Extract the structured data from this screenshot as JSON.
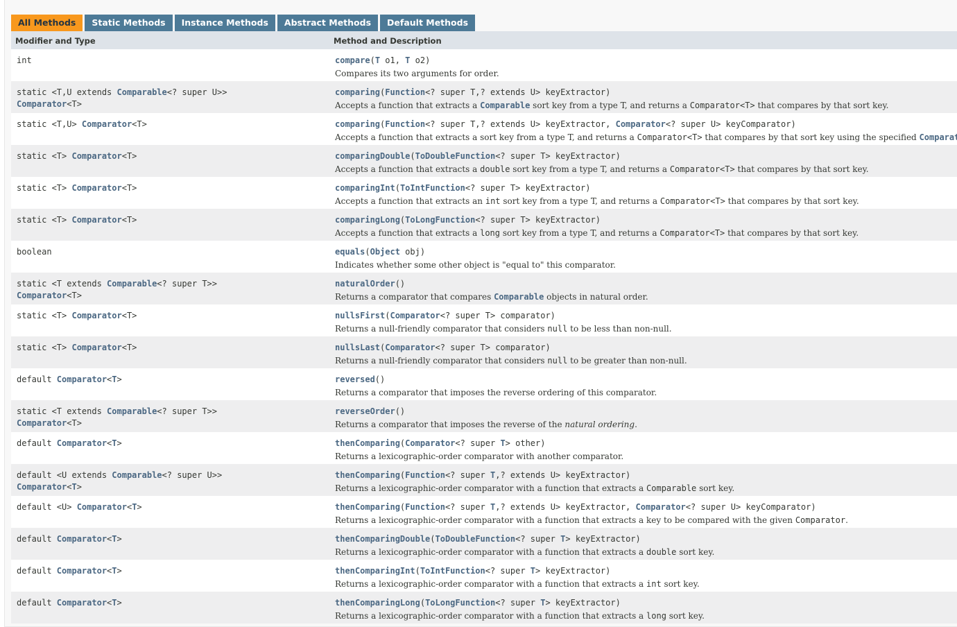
{
  "tabs": [
    {
      "label": "All Methods",
      "active": true
    },
    {
      "label": "Static Methods",
      "active": false
    },
    {
      "label": "Instance Methods",
      "active": false
    },
    {
      "label": "Abstract Methods",
      "active": false
    },
    {
      "label": "Default Methods",
      "active": false
    }
  ],
  "table": {
    "headers": {
      "col1": "Modifier and Type",
      "col2": "Method and Description"
    },
    "rows": [
      {
        "type": [
          [
            [
              "t",
              "int"
            ]
          ]
        ],
        "sig": [
          [
            "m",
            "compare"
          ],
          [
            "t",
            "("
          ],
          [
            "l",
            "T"
          ],
          [
            "t",
            " o1, "
          ],
          [
            "l",
            "T"
          ],
          [
            "t",
            " o2)"
          ]
        ],
        "desc": [
          [
            "t",
            "Compares its two arguments for order."
          ]
        ]
      },
      {
        "type": [
          [
            [
              "t",
              "static <T,U extends "
            ],
            [
              "l",
              "Comparable"
            ],
            [
              "t",
              "<? super U>>"
            ]
          ],
          [
            [
              "l",
              "Comparator"
            ],
            [
              "t",
              "<T>"
            ]
          ]
        ],
        "sig": [
          [
            "m",
            "comparing"
          ],
          [
            "t",
            "("
          ],
          [
            "l",
            "Function"
          ],
          [
            "t",
            "<? super T,? extends U> keyExtractor)"
          ]
        ],
        "desc": [
          [
            "t",
            "Accepts a function that extracts a "
          ],
          [
            "l",
            "Comparable"
          ],
          [
            "t",
            " sort key from a type T, and returns a "
          ],
          [
            "c",
            "Comparator<T>"
          ],
          [
            "t",
            " that compares by that sort key."
          ]
        ]
      },
      {
        "type": [
          [
            [
              "t",
              "static <T,U> "
            ],
            [
              "l",
              "Comparator"
            ],
            [
              "t",
              "<T>"
            ]
          ]
        ],
        "sig": [
          [
            "m",
            "comparing"
          ],
          [
            "t",
            "("
          ],
          [
            "l",
            "Function"
          ],
          [
            "t",
            "<? super T,? extends U> keyExtractor, "
          ],
          [
            "l",
            "Comparator"
          ],
          [
            "t",
            "<? super U> keyComparator)"
          ]
        ],
        "desc": [
          [
            "t",
            "Accepts a function that extracts a sort key from a type T, and returns a "
          ],
          [
            "c",
            "Comparator<T>"
          ],
          [
            "t",
            " that compares by that sort key using the specified "
          ],
          [
            "l",
            "Comparator"
          ],
          [
            "t",
            "."
          ]
        ]
      },
      {
        "type": [
          [
            [
              "t",
              "static <T> "
            ],
            [
              "l",
              "Comparator"
            ],
            [
              "t",
              "<T>"
            ]
          ]
        ],
        "sig": [
          [
            "m",
            "comparingDouble"
          ],
          [
            "t",
            "("
          ],
          [
            "l",
            "ToDoubleFunction"
          ],
          [
            "t",
            "<? super T> keyExtractor)"
          ]
        ],
        "desc": [
          [
            "t",
            "Accepts a function that extracts a "
          ],
          [
            "c",
            "double"
          ],
          [
            "t",
            " sort key from a type T, and returns a "
          ],
          [
            "c",
            "Comparator<T>"
          ],
          [
            "t",
            " that compares by that sort key."
          ]
        ]
      },
      {
        "type": [
          [
            [
              "t",
              "static <T> "
            ],
            [
              "l",
              "Comparator"
            ],
            [
              "t",
              "<T>"
            ]
          ]
        ],
        "sig": [
          [
            "m",
            "comparingInt"
          ],
          [
            "t",
            "("
          ],
          [
            "l",
            "ToIntFunction"
          ],
          [
            "t",
            "<? super T> keyExtractor)"
          ]
        ],
        "desc": [
          [
            "t",
            "Accepts a function that extracts an "
          ],
          [
            "c",
            "int"
          ],
          [
            "t",
            " sort key from a type T, and returns a "
          ],
          [
            "c",
            "Comparator<T>"
          ],
          [
            "t",
            " that compares by that sort key."
          ]
        ]
      },
      {
        "type": [
          [
            [
              "t",
              "static <T> "
            ],
            [
              "l",
              "Comparator"
            ],
            [
              "t",
              "<T>"
            ]
          ]
        ],
        "sig": [
          [
            "m",
            "comparingLong"
          ],
          [
            "t",
            "("
          ],
          [
            "l",
            "ToLongFunction"
          ],
          [
            "t",
            "<? super T> keyExtractor)"
          ]
        ],
        "desc": [
          [
            "t",
            "Accepts a function that extracts a "
          ],
          [
            "c",
            "long"
          ],
          [
            "t",
            " sort key from a type T, and returns a "
          ],
          [
            "c",
            "Comparator<T>"
          ],
          [
            "t",
            " that compares by that sort key."
          ]
        ]
      },
      {
        "type": [
          [
            [
              "t",
              "boolean"
            ]
          ]
        ],
        "sig": [
          [
            "m",
            "equals"
          ],
          [
            "t",
            "("
          ],
          [
            "l",
            "Object"
          ],
          [
            "t",
            " obj)"
          ]
        ],
        "desc": [
          [
            "t",
            "Indicates whether some other object is \"equal to\" this comparator."
          ]
        ]
      },
      {
        "type": [
          [
            [
              "t",
              "static <T extends "
            ],
            [
              "l",
              "Comparable"
            ],
            [
              "t",
              "<? super T>>"
            ]
          ],
          [
            [
              "l",
              "Comparator"
            ],
            [
              "t",
              "<T>"
            ]
          ]
        ],
        "sig": [
          [
            "m",
            "naturalOrder"
          ],
          [
            "t",
            "()"
          ]
        ],
        "desc": [
          [
            "t",
            "Returns a comparator that compares "
          ],
          [
            "l",
            "Comparable"
          ],
          [
            "t",
            " objects in natural order."
          ]
        ]
      },
      {
        "type": [
          [
            [
              "t",
              "static <T> "
            ],
            [
              "l",
              "Comparator"
            ],
            [
              "t",
              "<T>"
            ]
          ]
        ],
        "sig": [
          [
            "m",
            "nullsFirst"
          ],
          [
            "t",
            "("
          ],
          [
            "l",
            "Comparator"
          ],
          [
            "t",
            "<? super T> comparator)"
          ]
        ],
        "desc": [
          [
            "t",
            "Returns a null-friendly comparator that considers "
          ],
          [
            "c",
            "null"
          ],
          [
            "t",
            " to be less than non-null."
          ]
        ]
      },
      {
        "type": [
          [
            [
              "t",
              "static <T> "
            ],
            [
              "l",
              "Comparator"
            ],
            [
              "t",
              "<T>"
            ]
          ]
        ],
        "sig": [
          [
            "m",
            "nullsLast"
          ],
          [
            "t",
            "("
          ],
          [
            "l",
            "Comparator"
          ],
          [
            "t",
            "<? super T> comparator)"
          ]
        ],
        "desc": [
          [
            "t",
            "Returns a null-friendly comparator that considers "
          ],
          [
            "c",
            "null"
          ],
          [
            "t",
            " to be greater than non-null."
          ]
        ]
      },
      {
        "type": [
          [
            [
              "t",
              "default "
            ],
            [
              "l",
              "Comparator"
            ],
            [
              "t",
              "<"
            ],
            [
              "l",
              "T"
            ],
            [
              "t",
              ">"
            ]
          ]
        ],
        "sig": [
          [
            "m",
            "reversed"
          ],
          [
            "t",
            "()"
          ]
        ],
        "desc": [
          [
            "t",
            "Returns a comparator that imposes the reverse ordering of this comparator."
          ]
        ]
      },
      {
        "type": [
          [
            [
              "t",
              "static <T extends "
            ],
            [
              "l",
              "Comparable"
            ],
            [
              "t",
              "<? super T>>"
            ]
          ],
          [
            [
              "l",
              "Comparator"
            ],
            [
              "t",
              "<T>"
            ]
          ]
        ],
        "sig": [
          [
            "m",
            "reverseOrder"
          ],
          [
            "t",
            "()"
          ]
        ],
        "desc": [
          [
            "t",
            "Returns a comparator that imposes the reverse of the "
          ],
          [
            "e",
            "natural ordering"
          ],
          [
            "t",
            "."
          ]
        ]
      },
      {
        "type": [
          [
            [
              "t",
              "default "
            ],
            [
              "l",
              "Comparator"
            ],
            [
              "t",
              "<"
            ],
            [
              "l",
              "T"
            ],
            [
              "t",
              ">"
            ]
          ]
        ],
        "sig": [
          [
            "m",
            "thenComparing"
          ],
          [
            "t",
            "("
          ],
          [
            "l",
            "Comparator"
          ],
          [
            "t",
            "<? super "
          ],
          [
            "l",
            "T"
          ],
          [
            "t",
            "> other)"
          ]
        ],
        "desc": [
          [
            "t",
            "Returns a lexicographic-order comparator with another comparator."
          ]
        ]
      },
      {
        "type": [
          [
            [
              "t",
              "default <U extends "
            ],
            [
              "l",
              "Comparable"
            ],
            [
              "t",
              "<? super U>>"
            ]
          ],
          [
            [
              "l",
              "Comparator"
            ],
            [
              "t",
              "<"
            ],
            [
              "l",
              "T"
            ],
            [
              "t",
              ">"
            ]
          ]
        ],
        "sig": [
          [
            "m",
            "thenComparing"
          ],
          [
            "t",
            "("
          ],
          [
            "l",
            "Function"
          ],
          [
            "t",
            "<? super "
          ],
          [
            "l",
            "T"
          ],
          [
            "t",
            ",? extends U> keyExtractor)"
          ]
        ],
        "desc": [
          [
            "t",
            "Returns a lexicographic-order comparator with a function that extracts a "
          ],
          [
            "c",
            "Comparable"
          ],
          [
            "t",
            " sort key."
          ]
        ]
      },
      {
        "type": [
          [
            [
              "t",
              "default <U> "
            ],
            [
              "l",
              "Comparator"
            ],
            [
              "t",
              "<"
            ],
            [
              "l",
              "T"
            ],
            [
              "t",
              ">"
            ]
          ]
        ],
        "sig": [
          [
            "m",
            "thenComparing"
          ],
          [
            "t",
            "("
          ],
          [
            "l",
            "Function"
          ],
          [
            "t",
            "<? super "
          ],
          [
            "l",
            "T"
          ],
          [
            "t",
            ",? extends U> keyExtractor, "
          ],
          [
            "l",
            "Comparator"
          ],
          [
            "t",
            "<? super U> keyComparator)"
          ]
        ],
        "desc": [
          [
            "t",
            "Returns a lexicographic-order comparator with a function that extracts a key to be compared with the given "
          ],
          [
            "c",
            "Comparator"
          ],
          [
            "t",
            "."
          ]
        ]
      },
      {
        "type": [
          [
            [
              "t",
              "default "
            ],
            [
              "l",
              "Comparator"
            ],
            [
              "t",
              "<"
            ],
            [
              "l",
              "T"
            ],
            [
              "t",
              ">"
            ]
          ]
        ],
        "sig": [
          [
            "m",
            "thenComparingDouble"
          ],
          [
            "t",
            "("
          ],
          [
            "l",
            "ToDoubleFunction"
          ],
          [
            "t",
            "<? super "
          ],
          [
            "l",
            "T"
          ],
          [
            "t",
            "> keyExtractor)"
          ]
        ],
        "desc": [
          [
            "t",
            "Returns a lexicographic-order comparator with a function that extracts a "
          ],
          [
            "c",
            "double"
          ],
          [
            "t",
            " sort key."
          ]
        ]
      },
      {
        "type": [
          [
            [
              "t",
              "default "
            ],
            [
              "l",
              "Comparator"
            ],
            [
              "t",
              "<"
            ],
            [
              "l",
              "T"
            ],
            [
              "t",
              ">"
            ]
          ]
        ],
        "sig": [
          [
            "m",
            "thenComparingInt"
          ],
          [
            "t",
            "("
          ],
          [
            "l",
            "ToIntFunction"
          ],
          [
            "t",
            "<? super "
          ],
          [
            "l",
            "T"
          ],
          [
            "t",
            "> keyExtractor)"
          ]
        ],
        "desc": [
          [
            "t",
            "Returns a lexicographic-order comparator with a function that extracts a "
          ],
          [
            "c",
            "int"
          ],
          [
            "t",
            " sort key."
          ]
        ]
      },
      {
        "type": [
          [
            [
              "t",
              "default "
            ],
            [
              "l",
              "Comparator"
            ],
            [
              "t",
              "<"
            ],
            [
              "l",
              "T"
            ],
            [
              "t",
              ">"
            ]
          ]
        ],
        "sig": [
          [
            "m",
            "thenComparingLong"
          ],
          [
            "t",
            "("
          ],
          [
            "l",
            "ToLongFunction"
          ],
          [
            "t",
            "<? super "
          ],
          [
            "l",
            "T"
          ],
          [
            "t",
            "> keyExtractor)"
          ]
        ],
        "desc": [
          [
            "t",
            "Returns a lexicographic-order comparator with a function that extracts a "
          ],
          [
            "c",
            "long"
          ],
          [
            "t",
            " sort key."
          ]
        ]
      }
    ]
  }
}
